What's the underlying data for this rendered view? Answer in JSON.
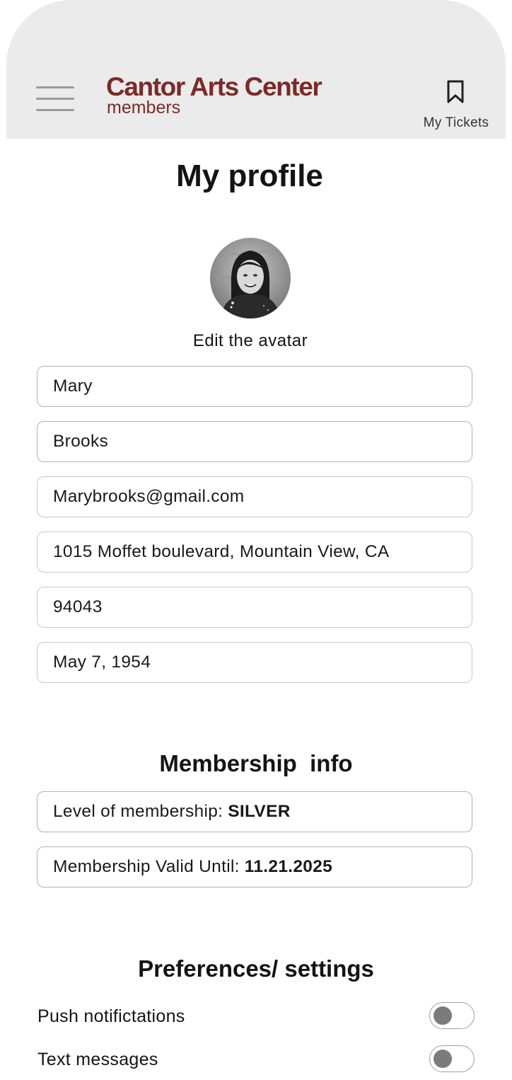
{
  "header": {
    "logo_main": "Cantor Arts Center",
    "logo_sub": "members",
    "tickets_label": "My Tickets"
  },
  "page_title": "My profile",
  "avatar": {
    "edit_label": "Edit the avatar"
  },
  "profile_fields": {
    "first_name": "Mary",
    "last_name": "Brooks",
    "email": "Marybrooks@gmail.com",
    "address": "1015 Moffet boulevard, Mountain View, CA",
    "zip": "94043",
    "birthdate": "May 7, 1954"
  },
  "membership": {
    "title": "Membership  info",
    "level_label": "Level of membership:",
    "level_value": "SILVER",
    "valid_label": "Membership Valid Until:",
    "valid_value": "11.21.2025"
  },
  "preferences": {
    "title": "Preferences/ settings",
    "items": [
      {
        "label": "Push notifictations",
        "enabled": false
      },
      {
        "label": "Text messages",
        "enabled": false
      }
    ]
  },
  "colors": {
    "brand": "#7b2b27",
    "header_bg": "#ebebeb"
  },
  "icons": {
    "menu": "hamburger-menu-icon",
    "tickets": "bookmark-icon"
  }
}
